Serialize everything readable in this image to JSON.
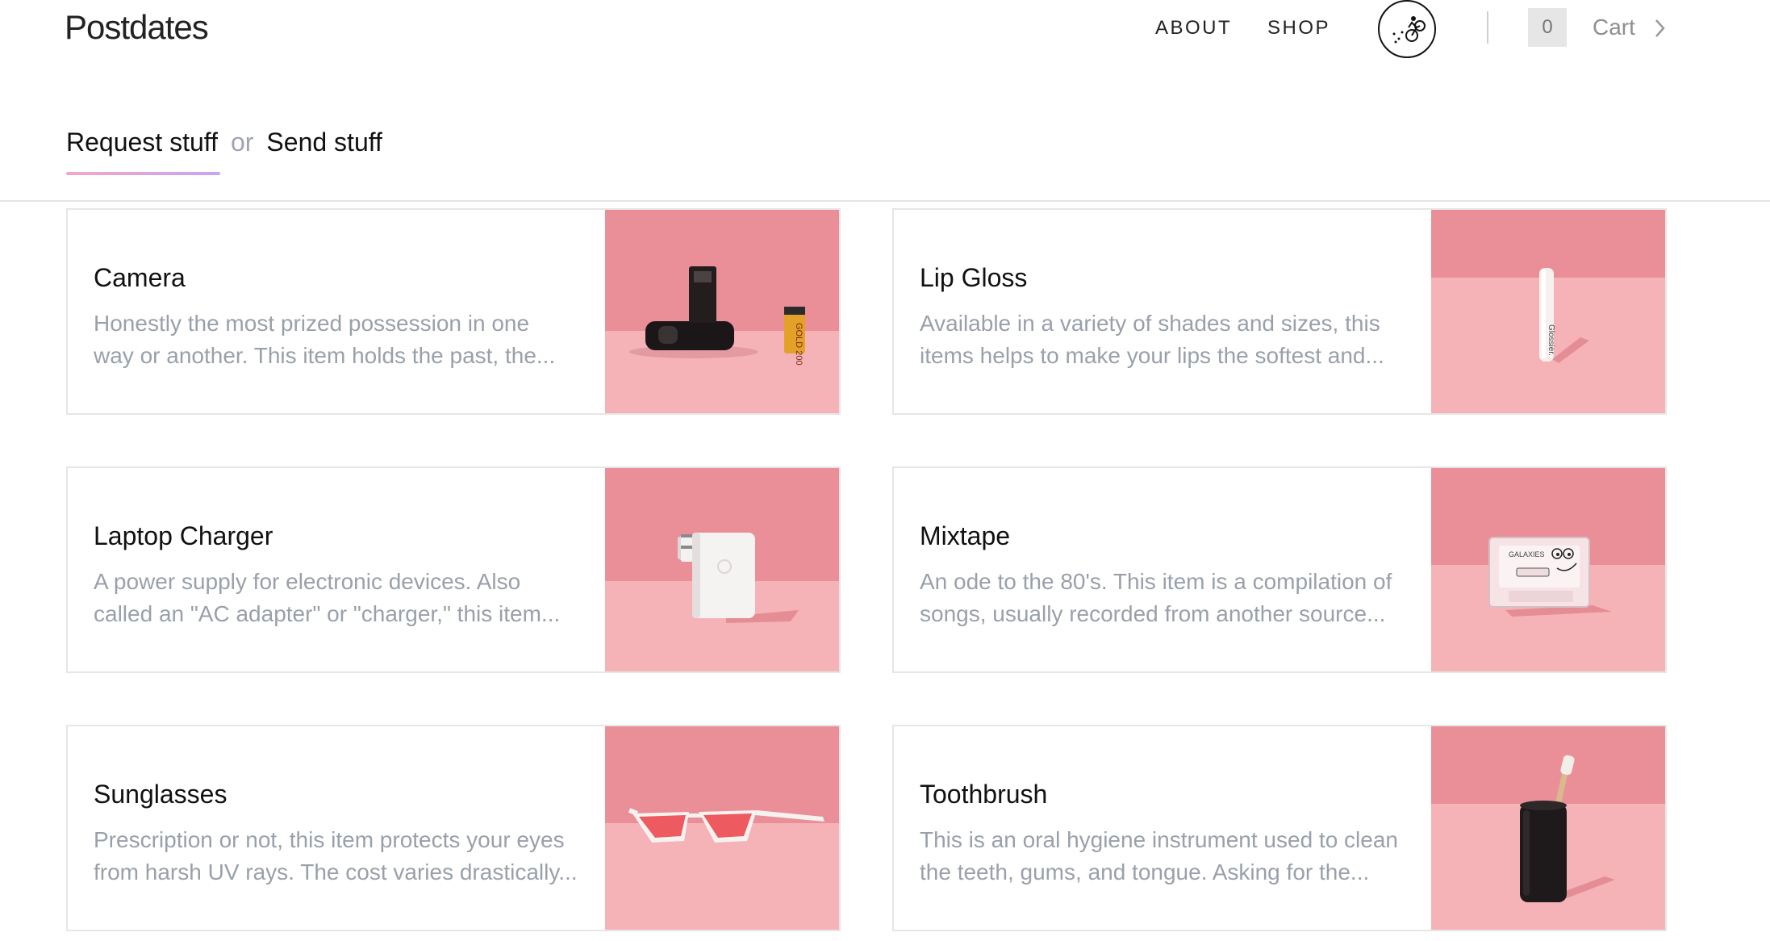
{
  "header": {
    "logo": "Postdates",
    "nav": {
      "about": "ABOUT",
      "shop": "SHOP"
    },
    "cart": {
      "count": "0",
      "label": "Cart"
    }
  },
  "tabs": {
    "request": "Request stuff",
    "or": "or",
    "send": "Send stuff"
  },
  "items": [
    {
      "title": "Camera",
      "desc_line1": "Honestly the most prized possession in one",
      "desc_line2": "way or another. This item holds the past, the...",
      "image": "camera-photo"
    },
    {
      "title": "Lip Gloss",
      "desc_line1": "Available in a variety of shades and sizes, this",
      "desc_line2": "items helps to make your lips the softest and...",
      "image": "lip-gloss-photo"
    },
    {
      "title": "Laptop Charger",
      "desc_line1": "A power supply for electronic devices. Also",
      "desc_line2": "called an \"AC adapter\" or \"charger,\" this item...",
      "image": "charger-photo"
    },
    {
      "title": "Mixtape",
      "desc_line1": "An ode to the 80's. This item is a compilation of",
      "desc_line2": "songs, usually recorded from another source...",
      "image": "cassette-photo"
    },
    {
      "title": "Sunglasses",
      "desc_line1": "Prescription or not, this item protects your eyes",
      "desc_line2": "from harsh UV rays. The cost varies drastically...",
      "image": "sunglasses-photo"
    },
    {
      "title": "Toothbrush",
      "desc_line1": "This is an oral hygiene instrument used to clean",
      "desc_line2": "the teeth, gums, and tongue. Asking for the...",
      "image": "toothbrush-photo"
    }
  ],
  "photo_labels": {
    "film": "GOLD 200",
    "gloss_brand": "Glossier.",
    "cassette": "GALAXIES"
  },
  "colors": {
    "photo_wall": "#ea8f98",
    "photo_floor": "#f5b3b8",
    "tab_underline_start": "#f4a6c8",
    "tab_underline_end": "#c9a3f5",
    "desc_text": "#9aa0ab"
  }
}
